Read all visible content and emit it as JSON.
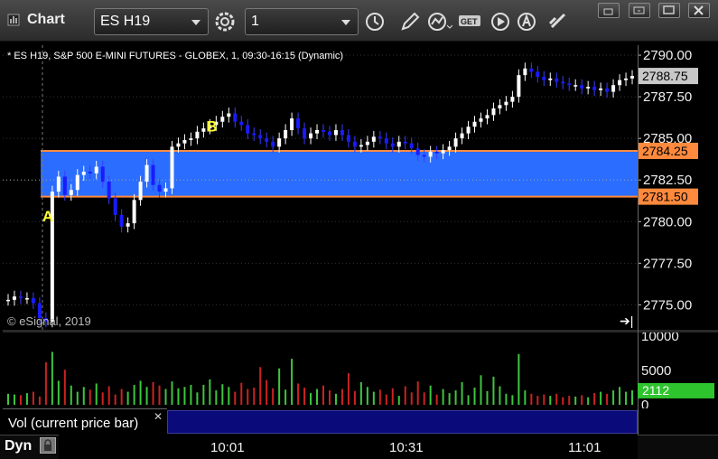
{
  "window": {
    "title": "Chart",
    "symbol": "ES H19",
    "interval": "1",
    "toolbar_icons": [
      "settings-gear-icon",
      "clock-icon",
      "pencil-draw-icon",
      "study-line-icon",
      "get-icon",
      "play-icon",
      "alert-icon",
      "link-icon"
    ],
    "window_buttons": [
      "restore-icon",
      "maximize-alt-icon",
      "maximize-icon",
      "close-icon"
    ]
  },
  "chart": {
    "header": "* ES H19, S&P 500 E-MINI FUTURES - GLOBEX, 1, 09:30-16:15 (Dynamic)",
    "copyright": "© eSignal, 2019",
    "markers": [
      {
        "label": "A",
        "x": 0,
        "price": 2781.2
      },
      {
        "label": "B",
        "x": 26,
        "price": 2785.2
      }
    ],
    "zone": {
      "top": 2784.25,
      "bottom": 2781.5,
      "color": "#2b6dff",
      "border": "#ff8a3d"
    },
    "current_price": "2788.75",
    "zone_top_label": "2784.25",
    "zone_bottom_label": "2781.50"
  },
  "chart_data": {
    "type": "candlestick",
    "price_axis": {
      "ticks": [
        "2790.00",
        "2787.50",
        "2785.00",
        "2782.50",
        "2780.00",
        "2777.50",
        "2775.00"
      ],
      "ylim": [
        2773.5,
        2790.6
      ]
    },
    "time_axis": {
      "ticks": [
        "10:01",
        "10:31",
        "11:01"
      ]
    },
    "closes": [
      2775.3,
      2775.5,
      2775.4,
      2775.4,
      2775.1,
      2774.2,
      2774.0,
      2781.8,
      2782.7,
      2781.6,
      2781.9,
      2782.8,
      2783.0,
      2782.9,
      2783.3,
      2782.4,
      2781.4,
      2780.4,
      2779.7,
      2779.9,
      2781.3,
      2782.4,
      2783.4,
      2782.2,
      2781.8,
      2782.0,
      2784.5,
      2784.7,
      2784.9,
      2785.0,
      2785.4,
      2785.6,
      2785.8,
      2786.0,
      2786.3,
      2786.5,
      2786.0,
      2785.8,
      2785.3,
      2785.2,
      2785.0,
      2784.8,
      2784.5,
      2785.0,
      2785.5,
      2786.2,
      2785.6,
      2785.0,
      2785.3,
      2785.5,
      2785.4,
      2785.2,
      2785.5,
      2785.2,
      2784.8,
      2784.5,
      2784.6,
      2784.8,
      2785.1,
      2785.0,
      2784.7,
      2784.5,
      2784.8,
      2784.7,
      2784.4,
      2784.0,
      2783.9,
      2784.2,
      2784.1,
      2784.3,
      2784.5,
      2785.0,
      2785.3,
      2785.7,
      2786.0,
      2786.2,
      2786.4,
      2786.8,
      2787.0,
      2787.2,
      2787.5,
      2788.8,
      2789.2,
      2789.0,
      2788.7,
      2788.5,
      2788.6,
      2788.4,
      2788.3,
      2788.2,
      2788.2,
      2788.0,
      2788.1,
      2787.9,
      2788.0,
      2787.8,
      2788.2,
      2788.5,
      2788.6,
      2788.75
    ],
    "volume_axis": {
      "ticks": [
        "10000",
        "5000",
        "0"
      ],
      "ylim": [
        0,
        10000
      ]
    },
    "volume": [
      1600,
      1500,
      1400,
      1700,
      1900,
      1200,
      6200,
      7700,
      3500,
      5100,
      2800,
      1900,
      2600,
      2200,
      3100,
      1800,
      2700,
      1500,
      2300,
      1900,
      2900,
      3500,
      2600,
      3300,
      2800,
      2300,
      3400,
      2400,
      2600,
      2900,
      1800,
      2900,
      3700,
      2100,
      3000,
      2600,
      1900,
      3200,
      2300,
      2500,
      5500,
      3600,
      2400,
      5300,
      2200,
      6700,
      3100,
      2500,
      1700,
      2300,
      2800,
      2100,
      1600,
      2300,
      4600,
      2000,
      3300,
      2600,
      1900,
      2200,
      1500,
      2400,
      1300,
      2700,
      1800,
      3400,
      1800,
      2800,
      1500,
      2300,
      1700,
      2100,
      3300,
      1400,
      2500,
      4300,
      2000,
      4100,
      2700,
      1600,
      1400,
      7400,
      2100,
      1600,
      1300,
      1500,
      1300,
      1600,
      1100,
      1300,
      1200,
      1400,
      1100,
      1700,
      1900,
      1600,
      2100,
      2600,
      1900,
      2112
    ],
    "current_volume": "2112",
    "volume_label": "Vol (current price bar)"
  },
  "bottom": {
    "mode": "Dyn"
  }
}
